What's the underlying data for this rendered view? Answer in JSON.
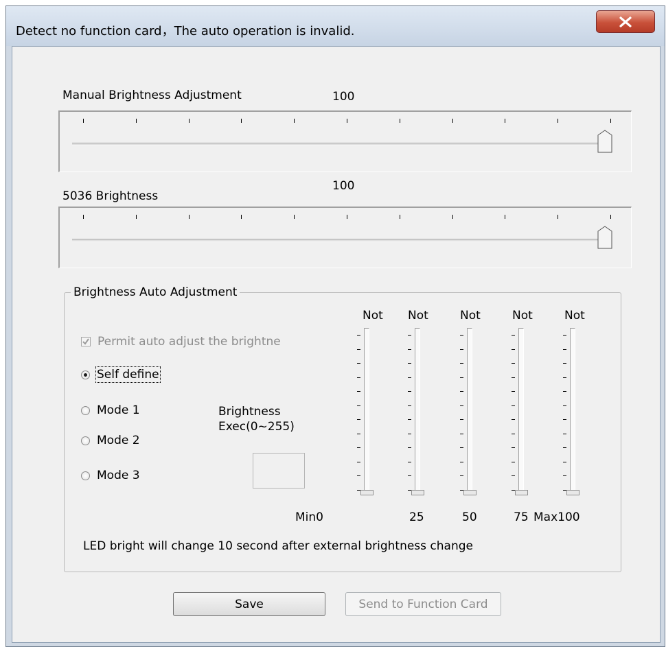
{
  "window": {
    "title": "Detect no function card，The auto operation is invalid.",
    "close_icon": "close-x-icon"
  },
  "manual": {
    "label": "Manual Brightness Adjustment",
    "value": "100",
    "ticks": 11,
    "level": 100
  },
  "b5036": {
    "label": "5036 Brightness",
    "value": "100",
    "ticks": 11,
    "level": 100
  },
  "auto": {
    "group_title": "Brightness Auto Adjustment",
    "permit_label": "Permit auto adjust the brightne",
    "permit_checked": true,
    "modes": [
      "Self define",
      "Mode 1",
      "Mode 2",
      "Mode 3"
    ],
    "selected_mode": "Self define",
    "exec_label_1": "Brightness",
    "exec_label_2": "Exec(0~255)",
    "exec_value": "",
    "sliders": [
      {
        "top": "Not",
        "bottom": "Min0"
      },
      {
        "top": "Not",
        "bottom": "25"
      },
      {
        "top": "Not",
        "bottom": "50"
      },
      {
        "top": "Not",
        "bottom": "75"
      },
      {
        "top": "Not",
        "bottom": "Max100"
      }
    ],
    "note": "LED bright will change 10 second after external brightness change"
  },
  "buttons": {
    "save": "Save",
    "send": "Send to Function Card"
  }
}
